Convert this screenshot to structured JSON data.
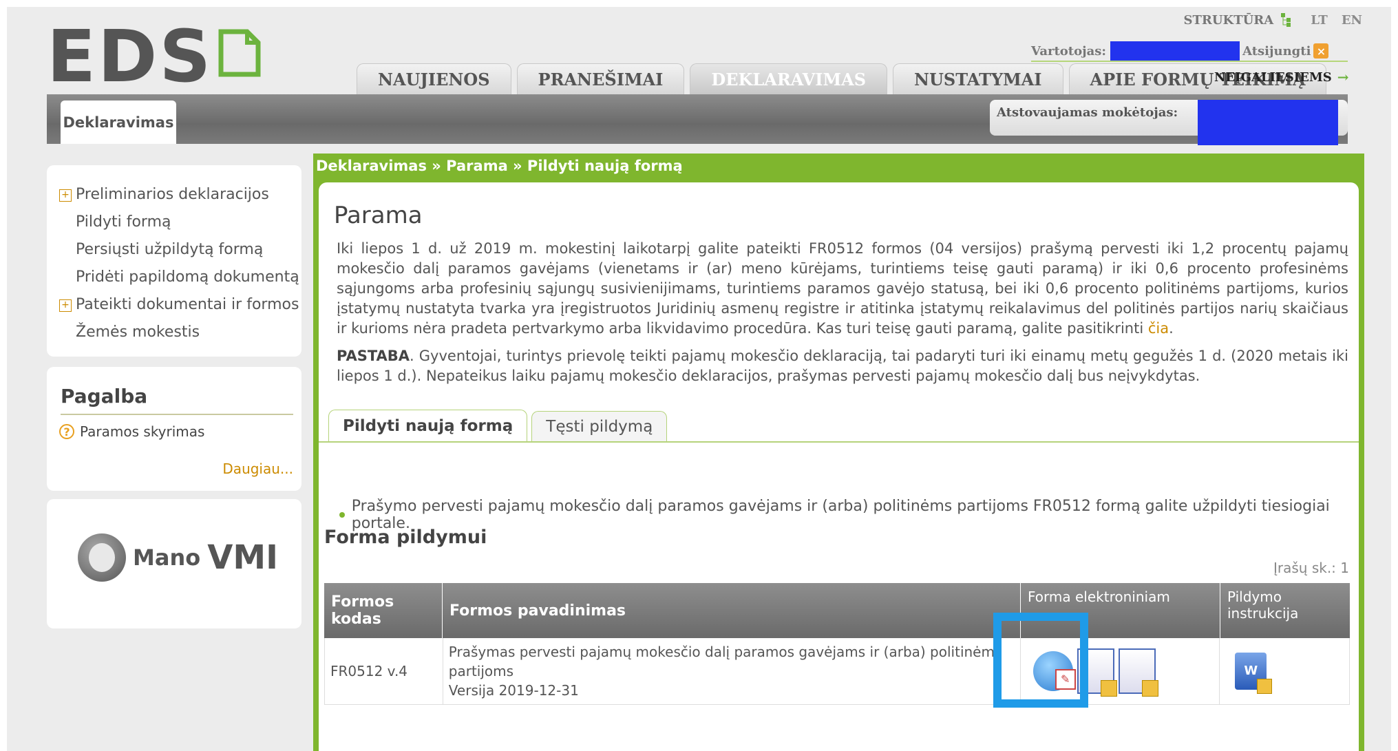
{
  "header": {
    "logo": "EDS",
    "structure_link": "STRUKTŪRA",
    "lang": [
      "LT",
      "EN"
    ],
    "user_label": "Vartotojas:",
    "logout": "Atsijungti",
    "tabs": [
      "NAUJIENOS",
      "PRANEŠIMAI",
      "DEKLARAVIMAS",
      "NUSTATYMAI",
      "APIE FORMŲ TEIKIMĄ"
    ],
    "active_tab": "DEKLARAVIMAS",
    "accessibility": "NEĮGALIESIEMS",
    "subtab": "Deklaravimas",
    "represented_label": "Atstovaujamas mokėtojas:"
  },
  "sidebar": {
    "items": [
      {
        "label": "Preliminarios deklaracijos",
        "expandable": true
      },
      {
        "label": "Pildyti formą",
        "expandable": false
      },
      {
        "label": "Persiųsti užpildytą formą",
        "expandable": false
      },
      {
        "label": "Pridėti papildomą dokumentą",
        "expandable": false
      },
      {
        "label": "Pateikti dokumentai ir formos",
        "expandable": true
      },
      {
        "label": "Žemės mokestis",
        "expandable": false
      }
    ],
    "help_title": "Pagalba",
    "help_link": "Paramos skyrimas",
    "more": "Daugiau...",
    "mano_small": "Mano",
    "mano_big": "VMI"
  },
  "main": {
    "breadcrumb": "Deklaravimas » Parama » Pildyti naują formą",
    "title": "Parama",
    "paragraph": "Iki liepos 1 d. už 2019 m. mokestinį laikotarpį galite pateikti FR0512 formos (04 versijos) prašymą pervesti iki 1,2 procentų pajamų mokesčio dalį paramos gavėjams (vienetams ir (ar) meno kūrėjams, turintiems teisę gauti paramą) ir iki 0,6 procento profesinėms sąjungoms arba profesinių sąjungų susivienijimams, turintiems paramos gavėjo statusą, bei iki 0,6 procento politinėms partijoms, kurios įstatymų nustatyta tvarka yra įregistruotos Juridinių asmenų registre ir atitinka įstatymų reikalavimus del politinės partijos narių skaičiaus ir kurioms nėra pradeta pertvarkymo arba likvidavimo procedūra. Kas turi teisę gauti paramą, galite pasitikrinti",
    "paragraph_link": "čia",
    "note_label": "PASTABA",
    "note": ". Gyventojai, turintys prievolę teikti pajamų mokesčio deklaraciją, tai padaryti turi iki einamų metų gegužės 1 d. (2020 metais iki liepos 1 d.). Nepateikus laiku pajamų mokesčio deklaracijos, prašymas pervesti pajamų mokesčio dalį bus neįvykdytas.",
    "inner_tabs": [
      "Pildyti naują formą",
      "Tęsti pildymą"
    ],
    "bullet": "Prašymo pervesti pajamų mokesčio dalį paramos gavėjams ir (arba) politinėms partijoms FR0512 formą galite užpildyti tiesiogiai portale.",
    "section_title": "Forma pildymui",
    "record_count": "Įrašų sk.: 1",
    "table": {
      "headers": [
        "Formos kodas",
        "Formos pavadinimas",
        "Forma elektroniniam",
        "Pildymo instrukcija"
      ],
      "rows": [
        {
          "code": "FR0512 v.4",
          "name_line1": "Prašymas pervesti pajamų mokesčio dalį paramos gavėjams ir (arba) politinėms",
          "name_line2": "partijoms",
          "version": "Versija 2019-12-31"
        }
      ]
    }
  }
}
